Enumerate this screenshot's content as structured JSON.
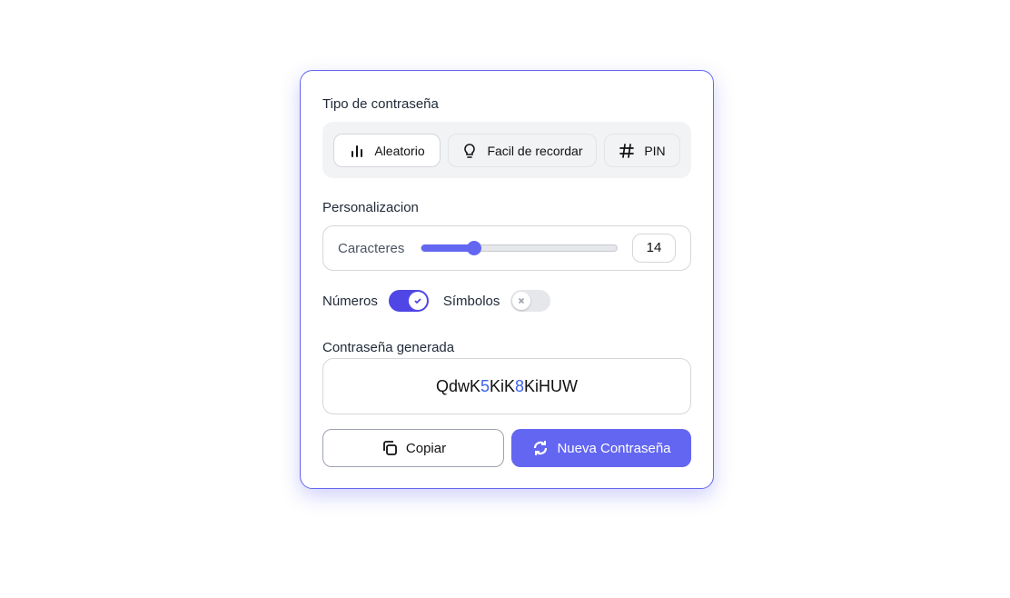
{
  "type_section": {
    "label": "Tipo de contraseña",
    "options": [
      {
        "label": "Aleatorio",
        "icon": "bar-chart-icon",
        "active": true
      },
      {
        "label": "Facil de recordar",
        "icon": "lightbulb-icon",
        "active": false
      },
      {
        "label": "PIN",
        "icon": "hash-icon",
        "active": false
      }
    ]
  },
  "custom_section": {
    "label": "Personalizacion",
    "length_label": "Caracteres",
    "length": "14",
    "slider_fraction": 0.27
  },
  "toggles": {
    "numbers_label": "Números",
    "numbers_on": true,
    "symbols_label": "Símbolos",
    "symbols_on": false
  },
  "generated": {
    "label": "Contraseña generada",
    "password": "QdwK5KiK8KiHUW",
    "parts": [
      {
        "t": "QdwK",
        "digit": false
      },
      {
        "t": "5",
        "digit": true
      },
      {
        "t": "KiK",
        "digit": false
      },
      {
        "t": "8",
        "digit": true
      },
      {
        "t": "KiHUW",
        "digit": false
      }
    ]
  },
  "actions": {
    "copy_label": "Copiar",
    "new_label": "Nueva Contraseña"
  },
  "colors": {
    "accent": "#6366f1",
    "toggle_on": "#4f46e5",
    "digit": "#3b63e6"
  }
}
